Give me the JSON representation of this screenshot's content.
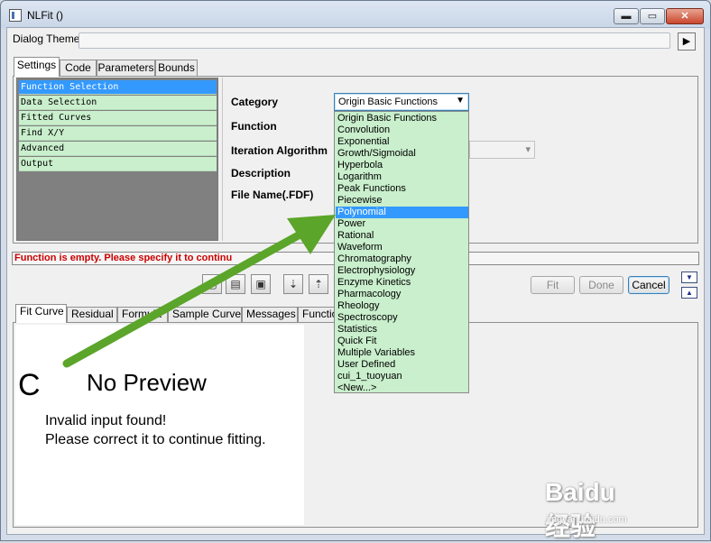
{
  "window": {
    "title": "NLFit ()"
  },
  "controls": {
    "min": "▬",
    "max": "▭",
    "close": "✕"
  },
  "theme": {
    "label": "Dialog Theme",
    "arrow": "▶"
  },
  "tabs": [
    "Settings",
    "Code",
    "Parameters",
    "Bounds"
  ],
  "nav": [
    "Function Selection",
    "Data Selection",
    "Fitted Curves",
    "Find X/Y",
    "Advanced",
    "Output"
  ],
  "form": {
    "category_label": "Category",
    "function_label": "Function",
    "iteration_label": "Iteration Algorithm",
    "description_label": "Description",
    "filename_label": "File Name(.FDF)",
    "category_value": "Origin Basic Functions"
  },
  "category_options": [
    "Origin Basic Functions",
    "Convolution",
    "Exponential",
    "Growth/Sigmoidal",
    "Hyperbola",
    "Logarithm",
    "Peak Functions",
    "Piecewise",
    "Polynomial",
    "Power",
    "Rational",
    "Waveform",
    "Chromatography",
    "Electrophysiology",
    "Enzyme Kinetics",
    "Pharmacology",
    "Rheology",
    "Spectroscopy",
    "Statistics",
    "Quick Fit",
    "Multiple Variables",
    "User Defined",
    "cui_1_tuoyuan",
    "<New...>"
  ],
  "selected_option": "Polynomial",
  "error": {
    "message": "Function is empty. Please specify it to continu"
  },
  "buttons": {
    "fit": "Fit",
    "done": "Done",
    "cancel": "Cancel"
  },
  "bottom_tabs": [
    "Fit Curve",
    "Residual",
    "Formula",
    "Sample Curve",
    "Messages",
    "Function"
  ],
  "preview": {
    "letter": "C",
    "title": "No Preview",
    "msg1": "Invalid input found!",
    "msg2": "Please correct it to continue fitting."
  },
  "watermark": {
    "text": "Baidu经验",
    "url": "jingyan.baidu.com"
  },
  "colors": {
    "accent": "#3399ff",
    "list_bg": "#c9efcc",
    "error": "#cc0000",
    "arrow": "#5ba52a"
  }
}
